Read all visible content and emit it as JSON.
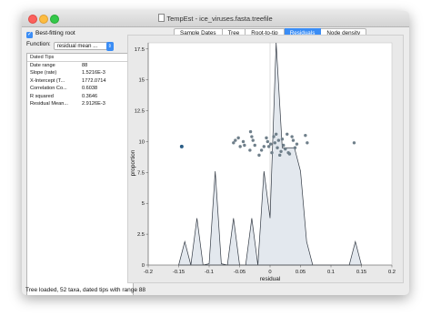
{
  "window": {
    "title": "TempEst - ice_viruses.fasta.treefile"
  },
  "left_panel": {
    "best_fitting_root_label": "Best-fitting root",
    "best_fitting_root_checked": true,
    "function_label": "Function:",
    "function_value": "residual mean ...",
    "tips_header": "Dated Tips",
    "rows": [
      {
        "key": "Date range",
        "value": "88"
      },
      {
        "key": "Slope (rate)",
        "value": "1.5216E-3"
      },
      {
        "key": "X-Intercept (T...",
        "value": "1772.0714"
      },
      {
        "key": "Correlation Co...",
        "value": "0.6038"
      },
      {
        "key": "R squared",
        "value": "0.3646"
      },
      {
        "key": "Residual Mean...",
        "value": "2.9126E-3"
      }
    ]
  },
  "tabs": [
    {
      "label": "Sample Dates",
      "active": false
    },
    {
      "label": "Tree",
      "active": false
    },
    {
      "label": "Root-to-tip",
      "active": false
    },
    {
      "label": "Residuals",
      "active": true
    },
    {
      "label": "Node density",
      "active": false
    }
  ],
  "status": "Tree loaded, 52 taxa, dated tips with range 88",
  "colors": {
    "tab_active": "#3b8df5",
    "area_fill": "#e3e8ee",
    "area_stroke": "#333a44",
    "point": "#6f7f8a",
    "highlight_point": "#2a5d86"
  },
  "chart_data": {
    "type": "scatter",
    "xlabel": "residual",
    "ylabel": "proportion",
    "xlim": [
      -0.2,
      0.2
    ],
    "ylim": [
      0,
      18
    ],
    "xticks": [
      -0.2,
      -0.15,
      -0.1,
      -0.05,
      0.0,
      0.05,
      0.1,
      0.15,
      0.2
    ],
    "xtick_labels": [
      "-0.2",
      "-0.15",
      "-0.1",
      "-0.05",
      "0",
      "0.05",
      "0.1",
      "0.15",
      "0.2"
    ],
    "yticks": [
      0,
      2.5,
      5,
      7.5,
      10,
      12.5,
      15,
      17.5
    ],
    "ytick_labels": [
      "0",
      "2.5",
      "5",
      "7.5",
      "10",
      "12.5",
      "15",
      "17.5"
    ],
    "density": {
      "x": [
        -0.15,
        -0.14,
        -0.13,
        -0.12,
        -0.11,
        -0.1,
        -0.09,
        -0.08,
        -0.07,
        -0.06,
        -0.05,
        -0.04,
        -0.03,
        -0.02,
        -0.01,
        0.0,
        0.01,
        0.02,
        0.03,
        0.04,
        0.05,
        0.06,
        0.07,
        0.08,
        0.09,
        0.1,
        0.11,
        0.12,
        0.13,
        0.14,
        0.15
      ],
      "y": [
        0,
        1.9,
        0,
        3.8,
        0,
        0.1,
        7.6,
        0.1,
        0,
        3.8,
        0,
        0,
        3.8,
        0,
        7.6,
        3.8,
        18.0,
        9.5,
        9.5,
        9.5,
        7.6,
        1.9,
        0,
        0,
        0,
        0,
        0,
        0,
        0,
        1.9,
        0
      ]
    },
    "points": {
      "x": [
        -0.145,
        -0.06,
        -0.057,
        -0.052,
        -0.049,
        -0.044,
        -0.042,
        -0.033,
        -0.032,
        -0.03,
        -0.028,
        -0.025,
        -0.018,
        -0.014,
        -0.01,
        -0.006,
        -0.004,
        -0.002,
        0.001,
        0.003,
        0.006,
        0.008,
        0.01,
        0.012,
        0.014,
        0.016,
        0.018,
        0.02,
        0.022,
        0.025,
        0.028,
        0.03,
        0.032,
        0.036,
        0.038,
        0.041,
        0.044,
        0.058,
        0.061,
        0.138
      ],
      "y": [
        9.6,
        9.9,
        10.1,
        10.3,
        9.6,
        10.0,
        9.7,
        9.3,
        10.8,
        10.4,
        10.1,
        9.7,
        8.9,
        9.3,
        9.6,
        10.3,
        10.0,
        9.6,
        9.8,
        9.1,
        10.4,
        9.9,
        10.6,
        9.5,
        10.1,
        8.9,
        9.2,
        10.2,
        9.7,
        9.4,
        10.6,
        9.1,
        9.0,
        10.4,
        10.1,
        9.5,
        9.8,
        10.5,
        9.9,
        9.9
      ],
      "highlight_index": 0
    }
  }
}
